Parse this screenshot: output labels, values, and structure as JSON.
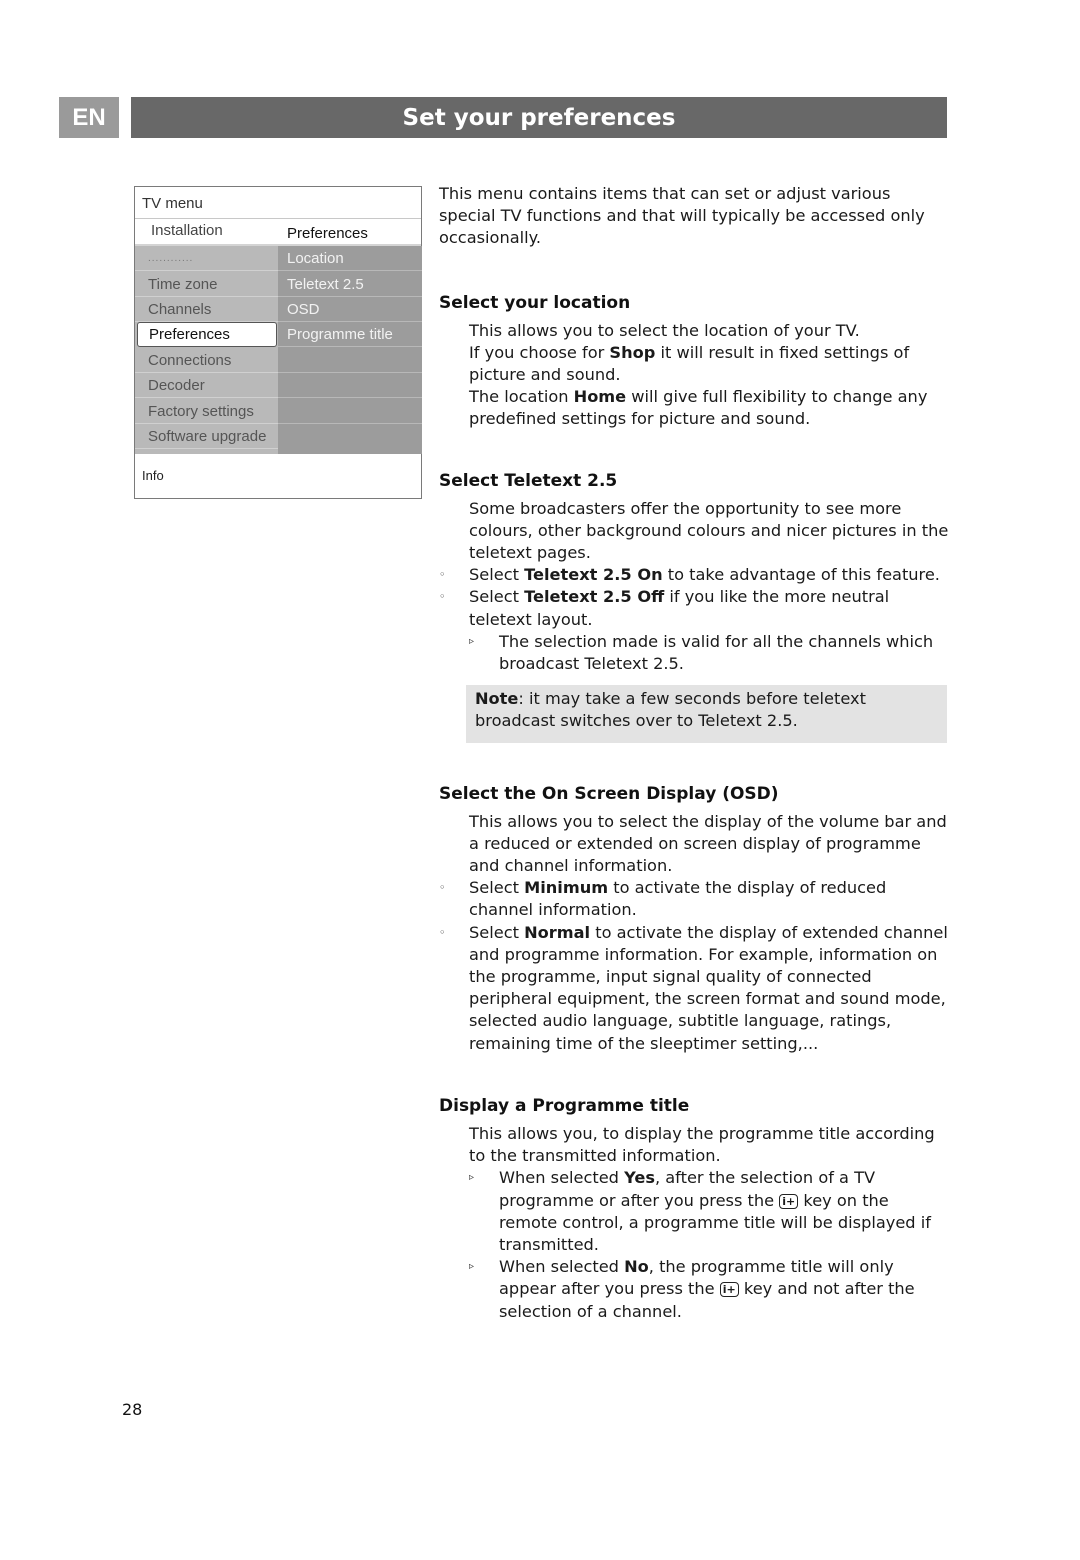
{
  "header": {
    "language": "EN",
    "title": "Set your preferences"
  },
  "tv_menu": {
    "title": "TV menu",
    "breadcrumb_left": "Installation",
    "breadcrumb_right": "Preferences",
    "left_items": [
      {
        "label": "............"
      },
      {
        "label": "Time zone"
      },
      {
        "label": "Channels"
      },
      {
        "label": "Preferences",
        "selected": true
      },
      {
        "label": "Connections"
      },
      {
        "label": "Decoder"
      },
      {
        "label": "Factory settings"
      },
      {
        "label": "Software upgrade"
      }
    ],
    "right_items": [
      {
        "label": "Location"
      },
      {
        "label": "Teletext 2.5"
      },
      {
        "label": "OSD"
      },
      {
        "label": "Programme title"
      }
    ],
    "info_label": "Info"
  },
  "intro": "This menu contains items that can set or adjust various special TV functions and that will typically be accessed only occasionally.",
  "sections": {
    "location": {
      "heading": "Select your location",
      "line1": "This allows you to select the location of your TV.",
      "line2_pre": "If you choose for ",
      "line2_bold": "Shop",
      "line2_post": " it will result in fixed settings of picture and sound.",
      "line3_pre": "The location ",
      "line3_bold": "Home",
      "line3_post": " will give full flexibility to change any predefined settings for picture and sound."
    },
    "teletext": {
      "heading": "Select Teletext 2.5",
      "body": "Some broadcasters offer the opportunity to see more colours, other background colours and nicer pictures in the teletext pages.",
      "bullet1_pre": "Select ",
      "bullet1_bold": "Teletext 2.5 On",
      "bullet1_post": " to take advantage of this feature.",
      "bullet2_pre": "Select ",
      "bullet2_bold": "Teletext 2.5 Off",
      "bullet2_post": " if you like the more neutral teletext layout.",
      "sub1": "The selection made is valid for all the channels which broadcast Teletext 2.5.",
      "note_bold": "Note",
      "note_text": ": it may take a few seconds before teletext broadcast switches over to Teletext 2.5."
    },
    "osd": {
      "heading": "Select the On Screen Display (OSD)",
      "body": "This allows you to select the display of the volume bar and a reduced or extended on screen display of programme and channel information.",
      "bullet1_pre": "Select ",
      "bullet1_bold": "Minimum",
      "bullet1_post": " to activate the display of reduced channel information.",
      "bullet2_pre": "Select ",
      "bullet2_bold": "Normal",
      "bullet2_post": " to activate the display of extended channel and programme information. For example, information on the programme, input signal quality of connected peripheral equipment, the screen format and sound mode, selected audio language, subtitle language, ratings, remaining time of the sleeptimer setting,..."
    },
    "programme_title": {
      "heading": "Display a Programme title",
      "body": "This allows you, to display the programme title according to the transmitted information.",
      "sub1_pre": "When selected ",
      "sub1_bold": "Yes",
      "sub1_mid": ", after the selection of a TV programme or after you press the ",
      "sub1_post": " key on the remote control, a  programme title will be displayed if transmitted.",
      "sub2_pre": "When selected ",
      "sub2_bold": "No",
      "sub2_mid": ", the programme title will only appear after you press the ",
      "sub2_post": " key and not after the selection of a channel.",
      "key_label": "i+"
    }
  },
  "markers": {
    "bullet": "◦",
    "sub": "▹"
  },
  "page_number": "28"
}
